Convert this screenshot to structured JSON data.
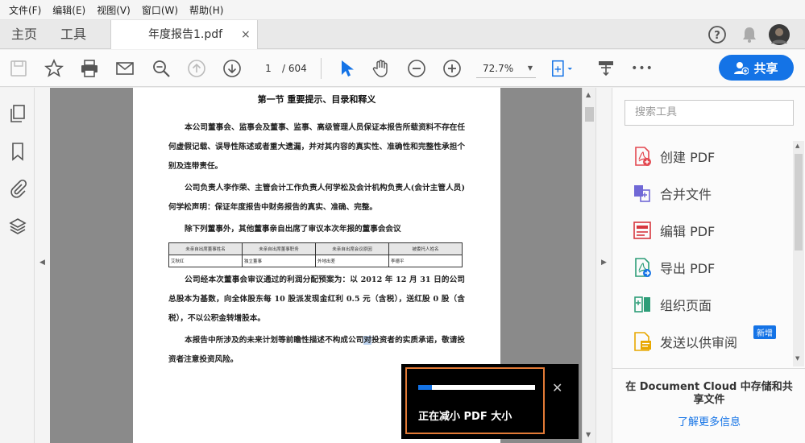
{
  "menubar": {
    "items": [
      "文件(F)",
      "编辑(E)",
      "视图(V)",
      "窗口(W)",
      "帮助(H)"
    ]
  },
  "tabs": {
    "home": "主页",
    "tools": "工具",
    "document": "年度报告1.pdf",
    "close": "×"
  },
  "toolbar": {
    "current_page": "1",
    "total_pages": "/ 604",
    "zoom": "72.7%",
    "more": "•••",
    "share_label": "共享"
  },
  "document": {
    "title": "第一节  重要提示、目录和释义",
    "para1": "本公司董事会、监事会及董事、监事、高级管理人员保证本报告所载资料不存在任何虚假记载、误导性陈述或者重大遗漏，并对其内容的真实性、准确性和完整性承担个别及连带责任。",
    "para2": "公司负责人李作荣、主管会计工作负责人何学松及会计机构负责人(会计主管人员)何学松声明：保证年度报告中财务报告的真实、准确、完整。",
    "para3": "除下列董事外，其他董事亲自出席了审议本次年报的董事会会议",
    "table": {
      "headers": [
        "未亲自出席董事姓名",
        "未亲自出席董事职务",
        "未亲自出席会议原因",
        "被委托人姓名"
      ],
      "row": [
        "艾秋红",
        "独立董事",
        "外地出差",
        "李德平"
      ]
    },
    "para4": "公司经本次董事会审议通过的利润分配预案为：以 2012 年 12 月 31 日的公司总股本为基数，向全体股东每 10 股派发现金红利 0.5 元（含税），送红股 0 股（含税），不以公积金转增股本。",
    "para5_a": "本报告中所涉及的未来计划等前瞻性描述不构成公司",
    "para5_hl": "对",
    "para5_b": "投资者的实质承诺，敬请投资者注意投资风险。"
  },
  "right_pane": {
    "search_placeholder": "搜索工具",
    "tools": [
      {
        "label": "创建 PDF",
        "icon": "create-pdf-icon"
      },
      {
        "label": "合并文件",
        "icon": "combine-files-icon"
      },
      {
        "label": "编辑 PDF",
        "icon": "edit-pdf-icon"
      },
      {
        "label": "导出 PDF",
        "icon": "export-pdf-icon"
      },
      {
        "label": "组织页面",
        "icon": "organize-pages-icon"
      },
      {
        "label": "发送以供审阅",
        "icon": "send-for-review-icon"
      }
    ],
    "new_badge": "新增",
    "cloud_title": "在 Document Cloud 中存储和共享文件",
    "cloud_link": "了解更多信息"
  },
  "toast": {
    "text": "正在减小 PDF 大小",
    "progress": 0.12,
    "close": "✕"
  },
  "colors": {
    "accent": "#1473e6",
    "toast_border": "#e27a36"
  }
}
